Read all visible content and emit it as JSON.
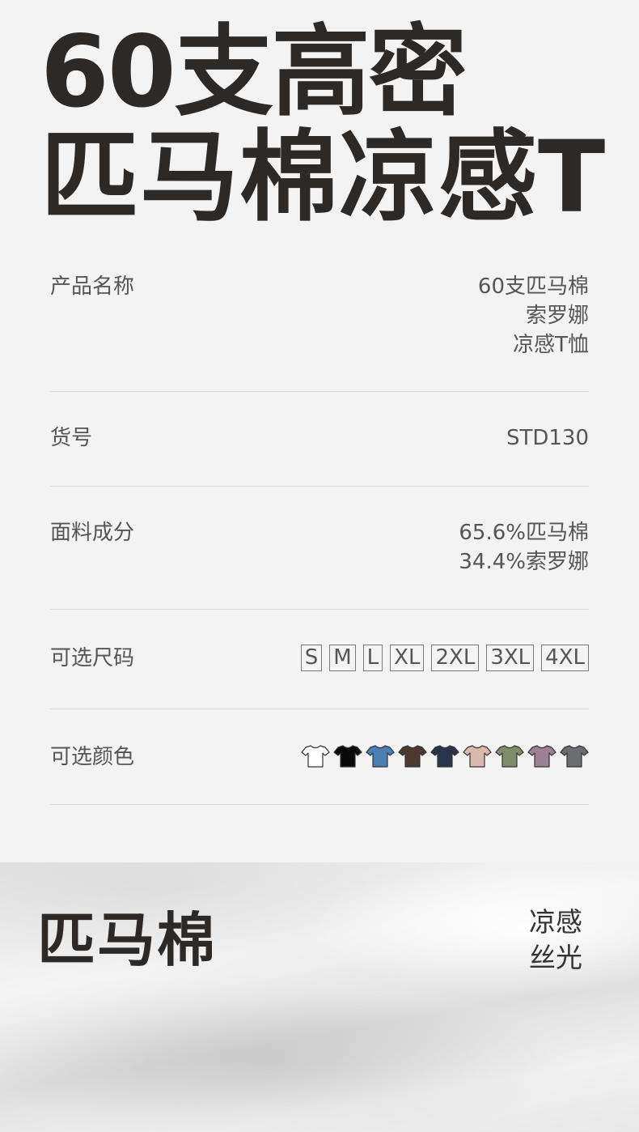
{
  "headline": {
    "line1": "60支高密",
    "line2": "匹马棉凉感T"
  },
  "specs": {
    "product_name": {
      "label": "产品名称",
      "values": [
        "60支匹马棉",
        "索罗娜",
        "凉感T恤"
      ]
    },
    "item_no": {
      "label": "货号",
      "value": "STD130"
    },
    "fabric": {
      "label": "面料成分",
      "values": [
        "65.6%匹马棉",
        "34.4%索罗娜"
      ]
    },
    "sizes": {
      "label": "可选尺码",
      "options": [
        "S",
        "M",
        "L",
        "XL",
        "2XL",
        "3XL",
        "4XL"
      ]
    },
    "colors": {
      "label": "可选颜色",
      "swatches": [
        "#ffffff",
        "#0a0a0a",
        "#4b7fb2",
        "#4a3a30",
        "#2a3448",
        "#d9b9ae",
        "#7e8d6c",
        "#9c8094",
        "#6a6e73"
      ]
    }
  },
  "fabric_section": {
    "title": "匹马棉",
    "features": [
      "凉感",
      "丝光"
    ]
  }
}
